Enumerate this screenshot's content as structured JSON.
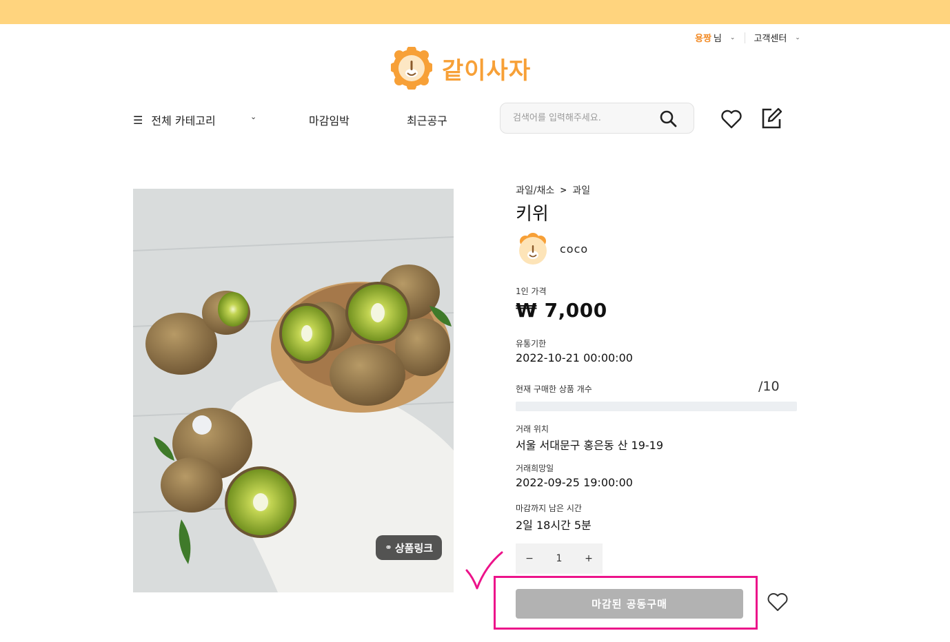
{
  "header": {
    "user_name": "용짱",
    "user_suffix": "님",
    "customer_center": "고객센터",
    "logo_text": "같이사자"
  },
  "nav": {
    "all_categories": "전체 카테고리",
    "closing_soon": "마감임박",
    "recent_group_buys": "최근공구",
    "search_placeholder": "검색어를 입력해주세요."
  },
  "product": {
    "breadcrumb_parent": "과일/채소",
    "breadcrumb_child": "과일",
    "title": "키위",
    "seller": "coco",
    "link_badge": "상품링크",
    "price_label": "1인 가격",
    "price": "₩ 7,000",
    "expiry_label": "유통기한",
    "expiry": "2022-10-21 00:00:00",
    "purchased_label": "현재 구매한 상품 개수",
    "purchased_count": "/10",
    "purchased_fraction": 0,
    "location_label": "거래 위치",
    "location": "서울 서대문구 홍은동 산 19-19",
    "desired_date_label": "거래희망일",
    "desired_date": "2022-09-25 19:00:00",
    "remaining_label": "마감까지 남은 시간",
    "remaining": "2일 18시간 5분",
    "quantity": "1",
    "minus": "−",
    "plus": "+",
    "buy_button": "마감된 공동구매"
  },
  "colors": {
    "topbar": "#ffd47e",
    "brand": "#f7a037",
    "highlight": "#ec138a",
    "disabled_button": "#b2b2b2"
  },
  "icons": [
    "menu-icon",
    "chevron-down-icon",
    "search-icon",
    "heart-icon",
    "edit-icon",
    "link-icon",
    "checkmark-icon"
  ]
}
